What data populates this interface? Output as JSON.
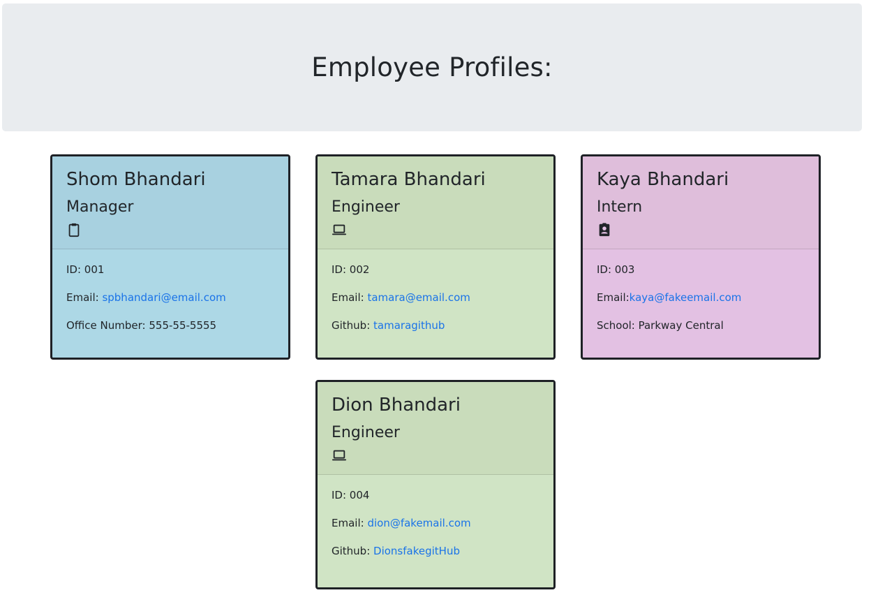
{
  "header": {
    "title": "Employee Profiles:"
  },
  "employees": [
    {
      "name": "Shom Bhandari",
      "role": "Manager",
      "icon": "clipboard-icon",
      "id_label": "ID: 001",
      "email_label": "Email: ",
      "email": "spbhandari@email.com",
      "extra_label": "Office Number: 555-55-5555",
      "color": "#add8e6"
    },
    {
      "name": "Tamara Bhandari",
      "role": "Engineer",
      "icon": "laptop-icon",
      "id_label": "ID: 002",
      "email_label": "Email: ",
      "email": "tamara@email.com",
      "extra_label": "Github: ",
      "github": "tamaragithub",
      "color": "#d0e4c5"
    },
    {
      "name": "Kaya Bhandari",
      "role": "Intern",
      "icon": "id-badge-icon",
      "id_label": "ID: 003",
      "email_label": "Email:",
      "email": "kaya@fakeemail.com",
      "extra_label": "School: Parkway Central",
      "color": "#e3c1e3"
    },
    {
      "name": "Dion Bhandari",
      "role": "Engineer",
      "icon": "laptop-icon",
      "id_label": "ID: 004",
      "email_label": "Email: ",
      "email": "dion@fakemail.com",
      "extra_label": "Github: ",
      "github": "DionsfakegitHub",
      "color": "#d0e4c5"
    }
  ]
}
